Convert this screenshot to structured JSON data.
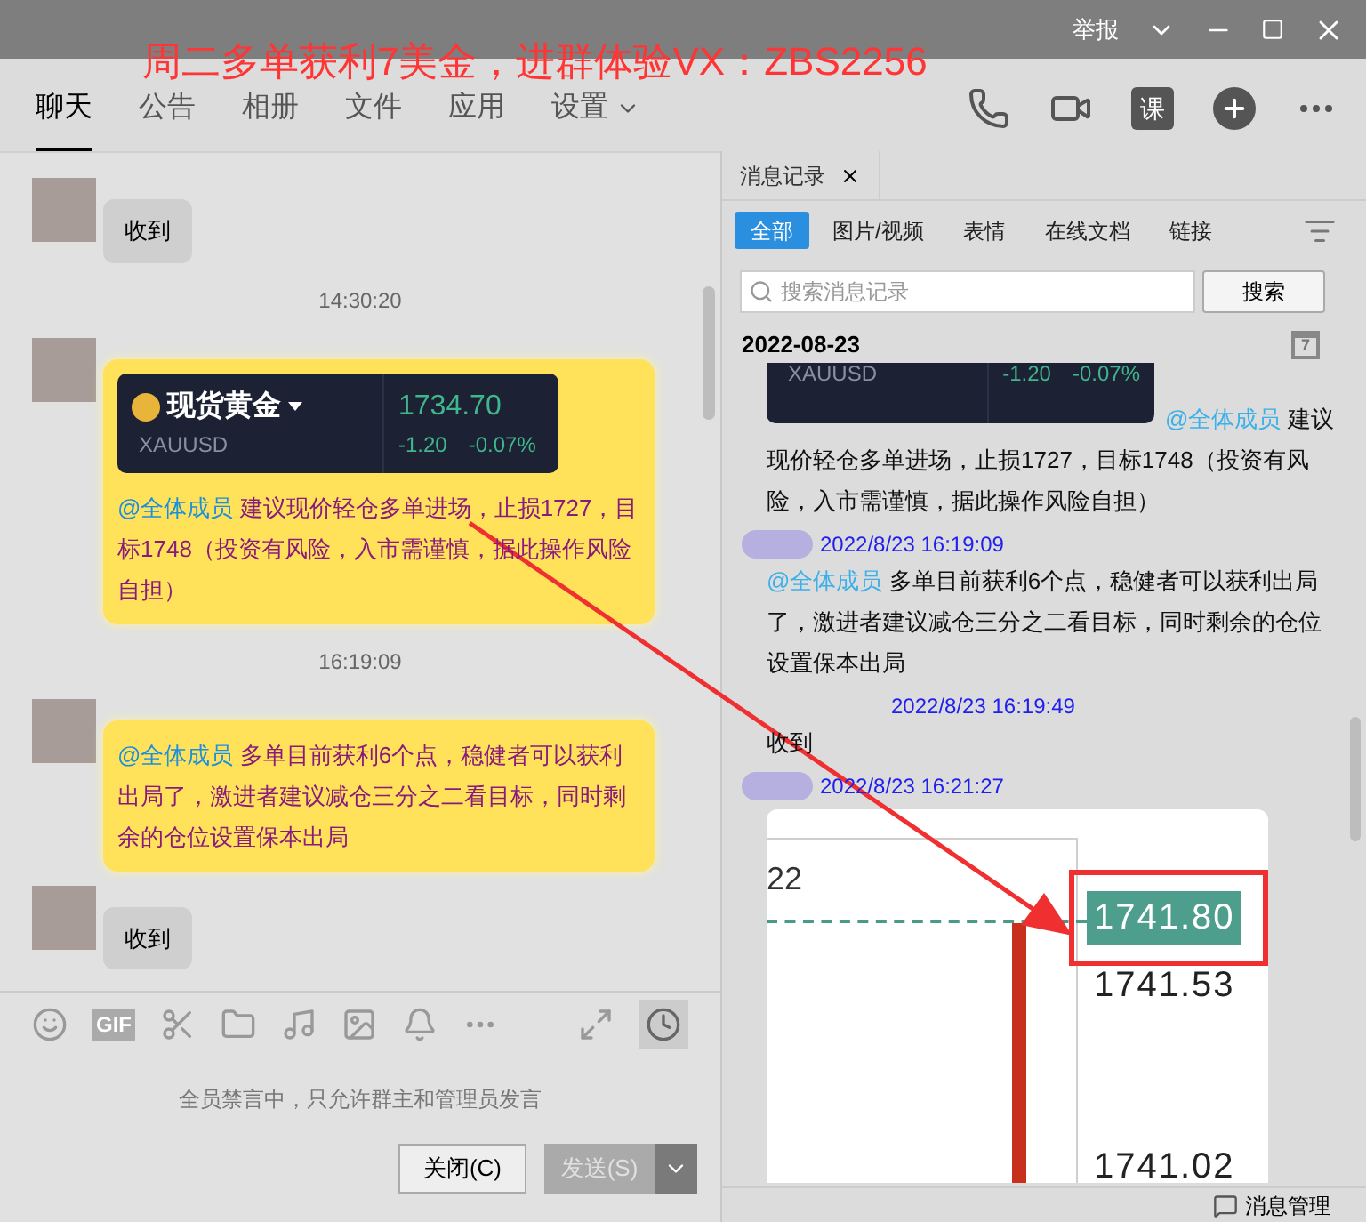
{
  "window": {
    "report": "举报"
  },
  "overlay_caption": "周二多单获利7美金，进群体验VX：ZBS2256",
  "tabs": [
    {
      "label": "聊天",
      "selected": true,
      "kind": "plain"
    },
    {
      "label": "公告",
      "selected": false,
      "kind": "plain"
    },
    {
      "label": "相册",
      "selected": false,
      "kind": "plain"
    },
    {
      "label": "文件",
      "selected": false,
      "kind": "plain"
    },
    {
      "label": "应用",
      "selected": false,
      "kind": "plain"
    },
    {
      "label": "设置",
      "selected": false,
      "kind": "menu"
    }
  ],
  "header_actions": {
    "course": "课"
  },
  "chat": {
    "messages": [
      {
        "kind": "text",
        "text": "收到"
      },
      {
        "kind": "time",
        "text": "14:30:20"
      },
      {
        "kind": "quote",
        "card": {
          "name": "现货黄金",
          "symbol": "XAUUSD",
          "price": "1734.70",
          "change": "-1.20",
          "change_pct": "-0.07%"
        },
        "mention": "@全体成员",
        "text": "建议现价轻仓多单进场，止损1727，目标1748（投资有风险，入市需谨慎，据此操作风险自担）"
      },
      {
        "kind": "time",
        "text": "16:19:09"
      },
      {
        "kind": "highlight",
        "mention": "@全体成员",
        "text": "多单目前获利6个点，稳健者可以获利出局了，激进者建议减仓三分之二看目标，同时剩余的仓位设置保本出局"
      },
      {
        "kind": "text",
        "text": "收到"
      }
    ]
  },
  "toolbar": {
    "gif_label": "GIF"
  },
  "input": {
    "notice": "全员禁言中，只允许群主和管理员发言"
  },
  "buttons": {
    "close": "关闭(C)",
    "send": "发送(S)",
    "send_disabled": true
  },
  "history": {
    "tab": "消息记录",
    "filters": [
      {
        "label": "全部",
        "selected": true
      },
      {
        "label": "图片/视频",
        "selected": false
      },
      {
        "label": "表情",
        "selected": false
      },
      {
        "label": "在线文档",
        "selected": false
      },
      {
        "label": "链接",
        "selected": false
      }
    ],
    "search": {
      "placeholder": "搜索消息记录",
      "button": "搜索"
    },
    "date": "2022-08-23",
    "calendar_day": "7",
    "entries": [
      {
        "kind": "card_text",
        "card": {
          "symbol": "XAUUSD",
          "change": "-1.20",
          "change_pct": "-0.07%"
        },
        "mention": "@全体成员",
        "text": "建议现价轻仓多单进场，止损1727，目标1748（投资有风险，入市需谨慎，据此操作风险自担）"
      },
      {
        "kind": "text",
        "time": "2022/8/23 16:19:09",
        "avatar": true,
        "mention": "@全体成员",
        "text": "多单目前获利6个点，稳健者可以获利出局了，激进者建议减仓三分之二看目标，同时剩余的仓位设置保本出局"
      },
      {
        "kind": "text",
        "time": "2022/8/23 16:19:49",
        "avatar": false,
        "text": "收到"
      },
      {
        "kind": "chart",
        "time": "2022/8/23 16:21:27",
        "avatar": true,
        "corner_label": "22",
        "current_price": "1741.80",
        "ticks": [
          "1741.53",
          "1741.02"
        ]
      }
    ],
    "footer": "消息管理"
  }
}
